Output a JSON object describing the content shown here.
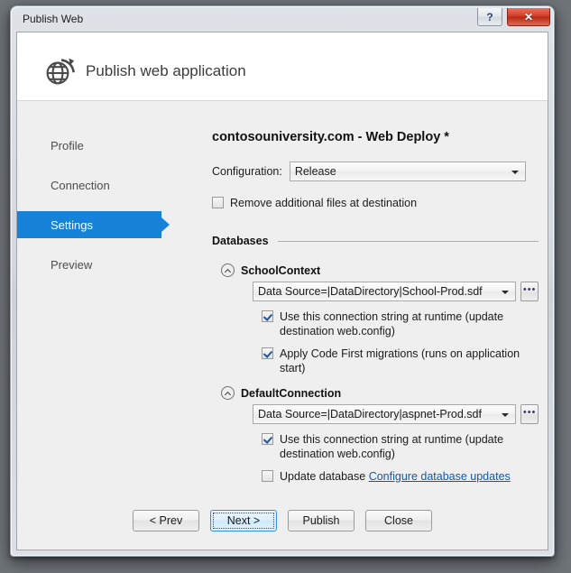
{
  "window": {
    "title": "Publish Web",
    "help_label": "?",
    "close_label": "✕"
  },
  "header": {
    "icon": "globe-publish-icon",
    "title": "Publish web application"
  },
  "sidebar": {
    "items": [
      {
        "label": "Profile",
        "selected": false
      },
      {
        "label": "Connection",
        "selected": false
      },
      {
        "label": "Settings",
        "selected": true
      },
      {
        "label": "Preview",
        "selected": false
      }
    ]
  },
  "main": {
    "profile_title": "contosouniversity.com - Web Deploy *",
    "configuration": {
      "label": "Configuration:",
      "value": "Release"
    },
    "remove_additional_files": {
      "label": "Remove additional files at destination",
      "checked": false
    },
    "databases_section_label": "Databases",
    "databases": [
      {
        "name": "SchoolContext",
        "expanded": true,
        "connection_string": "Data Source=|DataDirectory|School-Prod.sdf",
        "browse_label": "•••",
        "options": [
          {
            "label": "Use this connection string at runtime (update destination web.config)",
            "checked": true
          },
          {
            "label": "Apply Code First migrations (runs on application start)",
            "checked": true
          }
        ]
      },
      {
        "name": "DefaultConnection",
        "expanded": true,
        "connection_string": "Data Source=|DataDirectory|aspnet-Prod.sdf",
        "browse_label": "•••",
        "options": [
          {
            "label": "Use this connection string at runtime (update destination web.config)",
            "checked": true
          },
          {
            "label": "Update database",
            "checked": false,
            "link": "Configure database updates"
          }
        ]
      }
    ]
  },
  "footer": {
    "buttons": [
      {
        "label": "< Prev",
        "default": false
      },
      {
        "label": "Next >",
        "default": true
      },
      {
        "label": "Publish",
        "default": false
      },
      {
        "label": "Close",
        "default": false
      }
    ]
  },
  "colors": {
    "accent": "#1683d8",
    "link": "#1158b3",
    "close_button": "#c0392b",
    "body_background": "#efefef"
  }
}
